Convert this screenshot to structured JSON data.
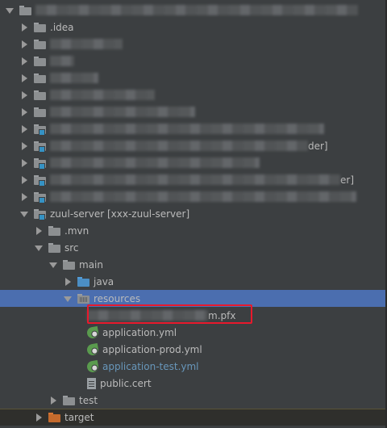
{
  "tree": {
    "rows": [
      {
        "indent": 0,
        "arrow": "down",
        "icon": "folder-grey",
        "label": "",
        "blur": 400
      },
      {
        "indent": 1,
        "arrow": "right",
        "icon": "folder-grey",
        "label": ".idea",
        "blur": 0
      },
      {
        "indent": 1,
        "arrow": "right",
        "icon": "folder-grey",
        "label": "",
        "blur": 90
      },
      {
        "indent": 1,
        "arrow": "right",
        "icon": "folder-grey",
        "label": "",
        "blur": 30
      },
      {
        "indent": 1,
        "arrow": "right",
        "icon": "folder-grey",
        "label": "",
        "blur": 60
      },
      {
        "indent": 1,
        "arrow": "right",
        "icon": "folder-grey",
        "label": "",
        "blur": 130
      },
      {
        "indent": 1,
        "arrow": "right",
        "icon": "folder-grey",
        "label": "",
        "blur": 180
      },
      {
        "indent": 1,
        "arrow": "right",
        "icon": "folder-module",
        "label": "",
        "blur": 340
      },
      {
        "indent": 1,
        "arrow": "right",
        "icon": "folder-module",
        "label": "der]",
        "blur": 320
      },
      {
        "indent": 1,
        "arrow": "right",
        "icon": "folder-module",
        "label": "",
        "blur": 260
      },
      {
        "indent": 1,
        "arrow": "right",
        "icon": "folder-module",
        "label": "er]",
        "blur": 360
      },
      {
        "indent": 1,
        "arrow": "right",
        "icon": "folder-module",
        "label": "",
        "blur": 380
      },
      {
        "indent": 1,
        "arrow": "down",
        "icon": "folder-module",
        "label": "zuul-server [xxx-zuul-server]",
        "blur": 0
      },
      {
        "indent": 2,
        "arrow": "right",
        "icon": "folder-grey",
        "label": ".mvn",
        "blur": 0
      },
      {
        "indent": 2,
        "arrow": "down",
        "icon": "folder-grey",
        "label": "src",
        "blur": 0
      },
      {
        "indent": 3,
        "arrow": "down",
        "icon": "folder-grey",
        "label": "main",
        "blur": 0
      },
      {
        "indent": 4,
        "arrow": "right",
        "icon": "folder-blue",
        "label": "java",
        "blur": 0
      },
      {
        "indent": 4,
        "arrow": "down",
        "icon": "folder-resources",
        "label": "resources",
        "blur": 0,
        "selected": true
      },
      {
        "indent": 5,
        "arrow": "none",
        "icon": "none",
        "label": "m.pfx",
        "blur": 150
      },
      {
        "indent": 5,
        "arrow": "none",
        "icon": "yml",
        "label": "application.yml",
        "blur": 0
      },
      {
        "indent": 5,
        "arrow": "none",
        "icon": "yml",
        "label": "application-prod.yml",
        "blur": 0
      },
      {
        "indent": 5,
        "arrow": "none",
        "icon": "yml",
        "label": "application-test.yml",
        "blur": 0,
        "style": "test-file"
      },
      {
        "indent": 5,
        "arrow": "none",
        "icon": "file",
        "label": "public.cert",
        "blur": 0
      },
      {
        "indent": 3,
        "arrow": "right",
        "icon": "folder-grey",
        "label": "test",
        "blur": 0
      },
      {
        "indent": 2,
        "arrow": "right",
        "icon": "folder-orange",
        "label": "target",
        "blur": 0,
        "last": true
      }
    ]
  },
  "colors": {
    "background": "#3c3f41",
    "selection": "#4b6eaf",
    "highlight_border": "#e8192c",
    "test_file_text": "#6897bb"
  }
}
